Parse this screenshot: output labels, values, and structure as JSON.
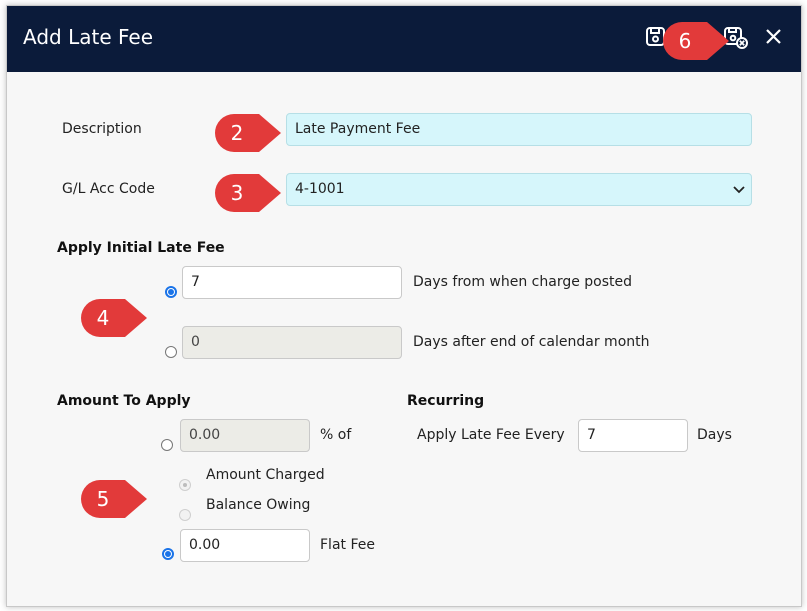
{
  "dialog": {
    "title": "Add Late Fee",
    "toolbar": {
      "save_icon": "save-icon",
      "save_close_icon": "save-close-icon",
      "close_icon": "close-icon"
    }
  },
  "form": {
    "description": {
      "label": "Description",
      "value": "Late Payment Fee"
    },
    "gl_code": {
      "label": "G/L Acc Code",
      "value": "4-1001"
    },
    "initial_fee": {
      "heading": "Apply Initial Late Fee",
      "option1": {
        "value": "7",
        "text": "Days from when charge posted",
        "selected": true
      },
      "option2": {
        "value": "0",
        "text": "Days after end of calendar month",
        "selected": false
      }
    },
    "amount": {
      "heading": "Amount To Apply",
      "percent": {
        "value": "0.00",
        "suffix": "% of",
        "selected": false
      },
      "sub_options": [
        "Amount Charged",
        "Balance Owing"
      ],
      "flat": {
        "value": "0.00",
        "label": "Flat Fee",
        "selected": true
      }
    },
    "recurring": {
      "heading": "Recurring",
      "label": "Apply Late Fee Every",
      "value": "7",
      "unit": "Days"
    }
  },
  "callouts": [
    "2",
    "3",
    "4",
    "5",
    "6"
  ],
  "colors": {
    "titlebar": "#0b1b3a",
    "callout": "#e23a3a",
    "highlight": "#d6f6fb",
    "radio_on": "#1a73e8"
  }
}
